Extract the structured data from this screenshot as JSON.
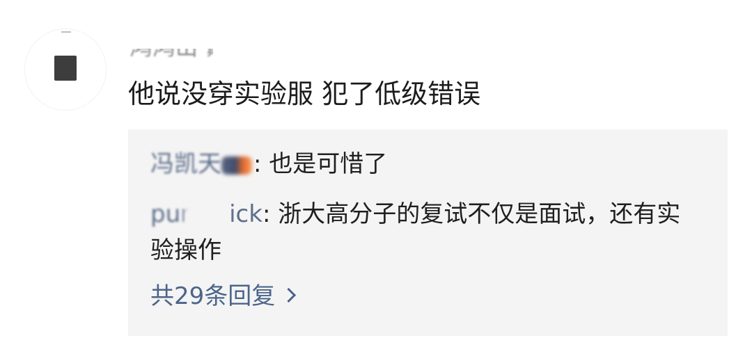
{
  "comment": {
    "username": "鸿鸿山 巅",
    "text": "他说没穿实验服  犯了低级错误"
  },
  "replies": [
    {
      "user": "冯凯天",
      "separator": ":",
      "text": " 也是可惜了"
    },
    {
      "user_prefix": "pur",
      "user_suffix": "ick",
      "separator": ":",
      "text": " 浙大高分子的复试不仅是面试，还有实验操作"
    }
  ],
  "more_replies": {
    "label": "共29条回复"
  },
  "colors": {
    "comment_text": "#1c1c1c",
    "username": "#8a8a8a",
    "reply_user": "#5e6e8c",
    "more_link": "#4c648a",
    "reply_box_bg": "#f4f4f4"
  },
  "icons": {
    "more": "chevron-right-icon"
  }
}
